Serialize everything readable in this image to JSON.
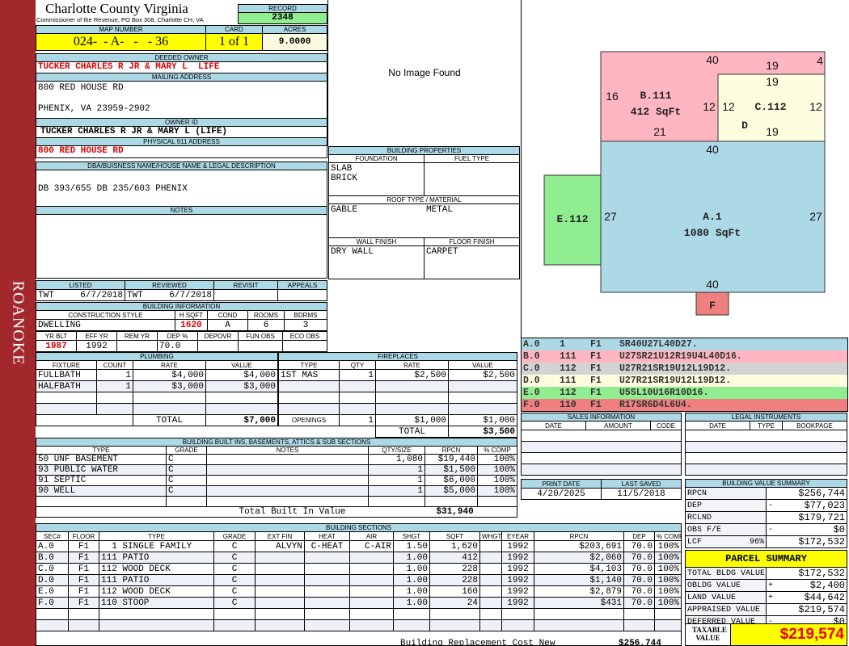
{
  "sidebar": {
    "label": "ROANOKE",
    "color": "#a3282c"
  },
  "header": {
    "title": "Charlotte County Virginia",
    "subtitle": "Commissioner of the Revenue, PO Box 308, Charlotte CH, VA",
    "record_label": "RECORD",
    "record": "2348"
  },
  "parcel": {
    "map_label": "MAP NUMBER",
    "map": "024-  - A-   -   - 36",
    "card_label": "CARD",
    "card": "1 of 1",
    "acres_label": "ACRES",
    "acres": "9.0000"
  },
  "owner": {
    "deeded_label": "DEEDED OWNER",
    "deeded": "TUCKER CHARLES R JR & MARY L  LIFE",
    "mailing_label": "MAILING ADDRESS",
    "mail1": "800 RED HOUSE RD",
    "mail2": "PHENIX, VA 23959-2902",
    "id_label": "OWNER ID",
    "id": "TUCKER CHARLES R JR & MARY L (LIFE)",
    "physical_label": "PHYSICAL 911 ADDRESS",
    "physical": "800 RED HOUSE RD"
  },
  "dba": {
    "label": "DBA/BUISNESS NAME/HOUSE NAME & LEGAL DESCRIPTION",
    "value": "DB 393/655 DB 235/603 PHENIX"
  },
  "notes": {
    "label": "NOTES",
    "value": ""
  },
  "review": {
    "headers": [
      "LISTED",
      "REVIEWED",
      "REVISIT",
      "APPEALS"
    ],
    "listed_by": "TWT",
    "listed": "6/7/2018",
    "reviewed_by": "TWT",
    "reviewed": "6/7/2018"
  },
  "building_info": {
    "label": "BUILDING INFORMATION",
    "h1": [
      "CONSTRUCTION STYLE",
      "H SQFT",
      "COND",
      "ROOMS",
      "BDRMS"
    ],
    "v1": [
      "DWELLING",
      "1620",
      "A",
      "6",
      "3"
    ],
    "h2": [
      "YR BLT",
      "EFF YR",
      "REM YR",
      "DEP %",
      "DEPOVR",
      "FUN OBS",
      "ECO OBS"
    ],
    "v2": [
      "1987",
      "1992",
      "",
      "70.0",
      "",
      "",
      ""
    ]
  },
  "image": {
    "text": "No Image Found"
  },
  "properties": {
    "label": "BUILDING PROPERTIES",
    "foundation_label": "FOUNDATION",
    "foundation": [
      "SLAB",
      "BRICK"
    ],
    "fuel_label": "FUEL TYPE",
    "roof_label": "ROOF TYPE / MATERIAL",
    "roof_type": "GABLE",
    "roof_material": "METAL",
    "wall_label": "WALL FINISH",
    "wall": "DRY WALL",
    "floor_label": "FLOOR FINISH",
    "floor": "CARPET"
  },
  "plumbing": {
    "label": "PLUMBING",
    "headers": [
      "FIXTURE",
      "COUNT",
      "RATE",
      "VALUE"
    ],
    "rows": [
      [
        "FULLBATH",
        "1",
        "$4,000",
        "$4,000"
      ],
      [
        "HALFBATH",
        "1",
        "$3,000",
        "$3,000"
      ],
      [
        "",
        "",
        "",
        ""
      ],
      [
        "",
        "",
        "",
        ""
      ]
    ],
    "total_label": "TOTAL",
    "total": "$7,000"
  },
  "fireplaces": {
    "label": "FIREPLACES",
    "headers": [
      "TYPE",
      "QTY",
      "RATE",
      "VALUE"
    ],
    "rows": [
      [
        "1ST MAS",
        "1",
        "$2,500",
        "$2,500"
      ],
      [
        "",
        "",
        "",
        ""
      ],
      [
        "",
        "",
        "",
        ""
      ],
      [
        "",
        "",
        "",
        ""
      ]
    ],
    "openings_label": "OPENINGS",
    "openings": [
      "1",
      "$1,000",
      "$1,000"
    ],
    "total_label": "TOTAL",
    "total": "$3,500"
  },
  "builtins": {
    "label": "BUILDING BUILT INS, BASEMENTS, ATTICS & SUB SECTIONS",
    "headers": [
      "TYPE",
      "GRADE",
      "NOTES",
      "QTY/SIZE",
      "RPCN",
      "% COMP"
    ],
    "rows": [
      [
        "50 UNF BASEMENT",
        "C",
        "",
        "1,080",
        "$19,440",
        "100%"
      ],
      [
        "93 PUBLIC WATER",
        "C",
        "",
        "1",
        "$1,500",
        "100%"
      ],
      [
        "91 SEPTIC",
        "C",
        "",
        "1",
        "$6,000",
        "100%"
      ],
      [
        "90 WELL",
        "C",
        "",
        "1",
        "$5,000",
        "100%"
      ],
      [
        "",
        "",
        "",
        "",
        "",
        ""
      ]
    ],
    "total_label": "Total Built In Value",
    "total": "$31,940"
  },
  "sections": {
    "label": "BUILDING SECTIONS",
    "headers": [
      "SEC#",
      "FLOOR",
      "TYPE",
      "GRADE",
      "EXT FIN",
      "HEAT",
      "AIR",
      "SHGT",
      "SQFT",
      "WHGT",
      "EYEAR",
      "RPCN",
      "DEP",
      "% COMP"
    ],
    "rows": [
      [
        "A.0",
        "F1",
        "  1 SINGLE FAMILY",
        "C",
        "ALVYN",
        "C-HEAT",
        "C-AIR",
        "1.50",
        "1,620",
        "",
        "1992",
        "$203,691",
        "70.0",
        "100%"
      ],
      [
        "B.0",
        "F1",
        "111 PATIO",
        "C",
        "",
        "",
        "",
        "1.00",
        "412",
        "",
        "1992",
        "$2,060",
        "70.0",
        "100%"
      ],
      [
        "C.0",
        "F1",
        "112 WOOD DECK",
        "C",
        "",
        "",
        "",
        "1.00",
        "228",
        "",
        "1992",
        "$4,103",
        "70.0",
        "100%"
      ],
      [
        "D.0",
        "F1",
        "111 PATIO",
        "C",
        "",
        "",
        "",
        "1.00",
        "228",
        "",
        "1992",
        "$1,140",
        "70.0",
        "100%"
      ],
      [
        "E.0",
        "F1",
        "112 WOOD DECK",
        "C",
        "",
        "",
        "",
        "1.00",
        "160",
        "",
        "1992",
        "$2,879",
        "70.0",
        "100%"
      ],
      [
        "F.0",
        "F1",
        "110 STOOP",
        "C",
        "",
        "",
        "",
        "1.00",
        "24",
        "",
        "1992",
        "$431",
        "70.0",
        "100%"
      ],
      [
        "",
        "",
        "",
        "",
        "",
        "",
        "",
        "",
        "",
        "",
        "",
        "",
        "",
        ""
      ],
      [
        "",
        "",
        "",
        "",
        "",
        "",
        "",
        "",
        "",
        "",
        "",
        "",
        "",
        ""
      ]
    ],
    "total_label": "Building Replacement Cost New",
    "total": "$256,744"
  },
  "sketch": {
    "labels": {
      "a": "A.1",
      "a_area": "1080 SqFt",
      "b": "B.111",
      "b_area": "412 SqFt",
      "c": "C.112",
      "d": "D",
      "e": "E.112",
      "f": "F"
    },
    "dims": [
      "40",
      "19",
      "4",
      "19",
      "16",
      "12",
      "12",
      "12",
      "21",
      "19",
      "40",
      "27",
      "27",
      "40"
    ],
    "colors": {
      "A": "#add8e6",
      "B": "#ffb6c1",
      "C": "#fffde0",
      "E": "#90ee90",
      "F": "#f08080"
    }
  },
  "codes": [
    {
      "sec": "A.0",
      "code": "1",
      "floor": "F1",
      "path": "SR40U27L40D27.",
      "color": "#add8e6"
    },
    {
      "sec": "B.0",
      "code": "111",
      "floor": "F1",
      "path": "U27SR21U12R19U4L40D16.",
      "color": "#ffb6c1"
    },
    {
      "sec": "C.0",
      "code": "112",
      "floor": "F1",
      "path": "U27R21SR19U12L19D12.",
      "color": "#d3d3d3"
    },
    {
      "sec": "D.0",
      "code": "111",
      "floor": "F1",
      "path": "U27R21SR19U12L19D12.",
      "color": "#fffde0"
    },
    {
      "sec": "E.0",
      "code": "112",
      "floor": "F1",
      "path": "U5SL10U16R10D16.",
      "color": "#90ee90"
    },
    {
      "sec": "F.0",
      "code": "110",
      "floor": "F1",
      "path": "R17SR6D4L6U4.",
      "color": "#f08080"
    }
  ],
  "sales": {
    "label": "SALES INFORMATION",
    "headers": [
      "DATE",
      "AMOUNT",
      "CODE"
    ]
  },
  "legal": {
    "label": "LEGAL INSTRUMENTS",
    "headers": [
      "DATE",
      "TYPE",
      "BOOKPAGE"
    ]
  },
  "dates": {
    "print_label": "PRINT DATE",
    "print": "4/20/2025",
    "saved_label": "LAST SAVED",
    "saved": "11/5/2018"
  },
  "value_summary": {
    "label": "BUILDING VALUE SUMMARY",
    "rows": [
      [
        "RPCN",
        "",
        "",
        "$256,744"
      ],
      [
        "DEP",
        "",
        "-",
        "$77,023"
      ],
      [
        "RCLND",
        "",
        "",
        "$179,721"
      ],
      [
        "OBS F/E",
        "",
        "-",
        "$0"
      ],
      [
        "LCF",
        "96%",
        "",
        "$172,532"
      ]
    ]
  },
  "parcel_summary": {
    "label": "PARCEL SUMMARY",
    "rows": [
      [
        "TOTAL BLDG VALUE",
        "",
        "$172,532"
      ],
      [
        "OBLDG VALUE",
        "+",
        "$2,400"
      ],
      [
        "LAND VALUE",
        "+",
        "$44,642"
      ],
      [
        "APPRAISED VALUE",
        "",
        "$219,574"
      ],
      [
        "DEFERRED VALUE",
        "-",
        "$0"
      ]
    ],
    "taxable_label": "TAXABLE VALUE",
    "taxable": "$219,574"
  }
}
